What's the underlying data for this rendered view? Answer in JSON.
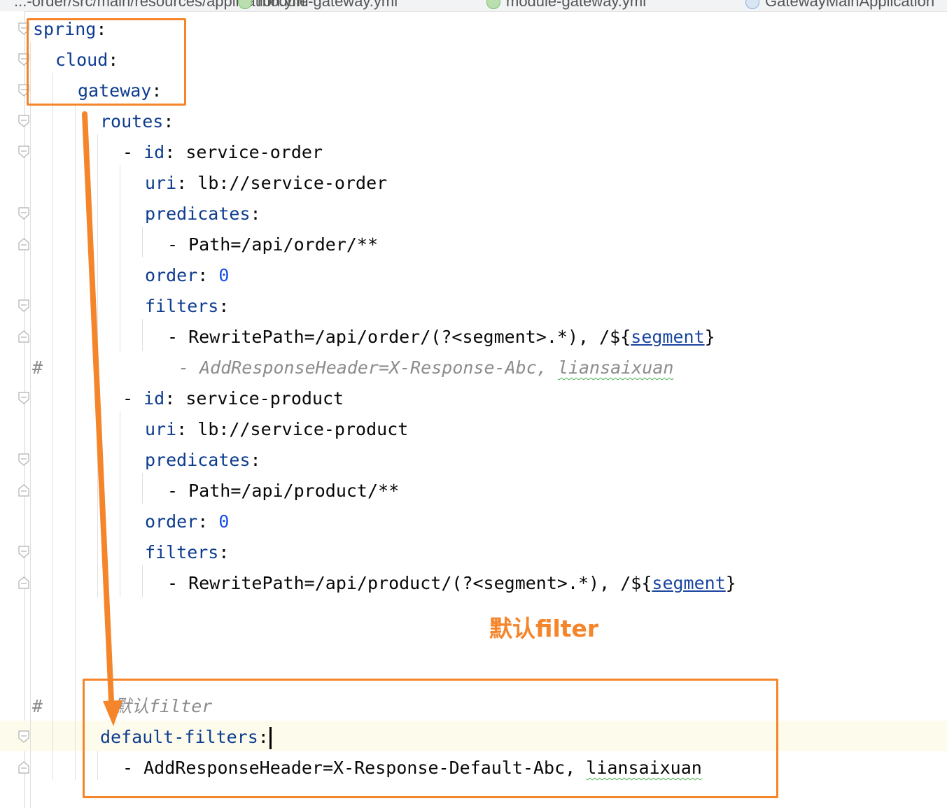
{
  "tabs": [
    {
      "label": "...-order/src/main/resources/application.yml"
    },
    {
      "label": "module-gateway.yml"
    },
    {
      "label": "module-gateway.yml"
    },
    {
      "label": "GatewayMainApplication"
    }
  ],
  "code": {
    "spring": "spring",
    "cloud": "cloud",
    "gateway": "gateway",
    "routes": "routes",
    "route1": {
      "id_key": "id",
      "id_val": "service-order",
      "uri_key": "uri",
      "uri_val": "lb://service-order",
      "predicates_key": "predicates",
      "predicate": "Path=/api/order/**",
      "order_key": "order",
      "order_val": "0",
      "filters_key": "filters",
      "rewrite_prefix": "RewritePath=/api/order/(?<segment>.*), /$",
      "rewrite_ref": "segment",
      "commented_prefix": "- AddResponseHeader=X-Response-Abc, ",
      "commented_name": "liansaixuan"
    },
    "route2": {
      "id_key": "id",
      "id_val": "service-product",
      "uri_key": "uri",
      "uri_val": "lb://service-product",
      "predicates_key": "predicates",
      "predicate": "Path=/api/product/**",
      "order_key": "order",
      "order_val": "0",
      "filters_key": "filters",
      "rewrite_prefix": "RewritePath=/api/product/(?<segment>.*), /$",
      "rewrite_ref": "segment"
    },
    "comment_default": "默认filter",
    "default_filters": "default-filters",
    "default_filter_prefix": "AddResponseHeader=X-Response-Default-Abc, ",
    "default_filter_name": "liansaixuan"
  },
  "annotation": {
    "label": "默认filter",
    "color": "#f5852a"
  }
}
